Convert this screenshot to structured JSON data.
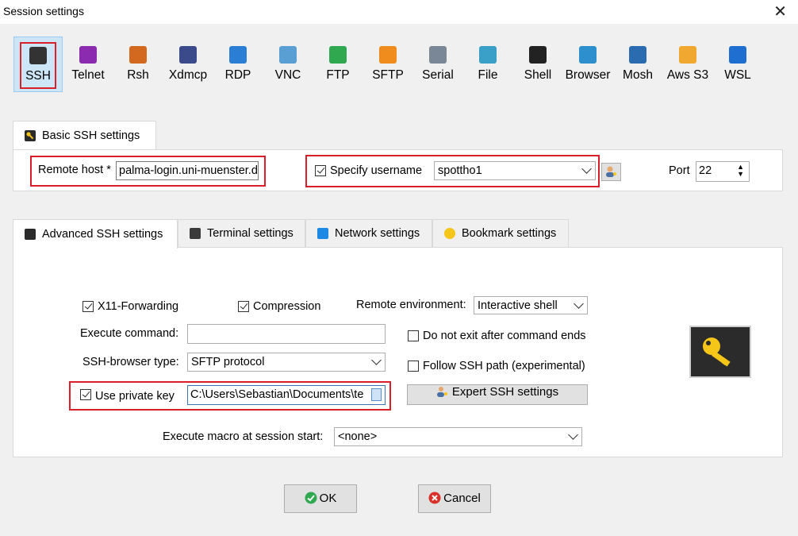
{
  "window": {
    "title": "Session settings",
    "close_glyph": "✕"
  },
  "protocols": [
    {
      "label": "SSH",
      "icon": "ssh-key-icon",
      "color": "#333333",
      "selected": true
    },
    {
      "label": "Telnet",
      "icon": "telnet-icon",
      "color": "#8a2bb0"
    },
    {
      "label": "Rsh",
      "icon": "rsh-icon",
      "color": "#d2691e"
    },
    {
      "label": "Xdmcp",
      "icon": "xdmcp-icon",
      "color": "#3b4a8a"
    },
    {
      "label": "RDP",
      "icon": "rdp-icon",
      "color": "#2a7fd4"
    },
    {
      "label": "VNC",
      "icon": "vnc-icon",
      "color": "#5a9fd4"
    },
    {
      "label": "FTP",
      "icon": "ftp-globe-icon",
      "color": "#2fa84f"
    },
    {
      "label": "SFTP",
      "icon": "sftp-globe-icon",
      "color": "#f08c1e"
    },
    {
      "label": "Serial",
      "icon": "serial-plug-icon",
      "color": "#7a8796"
    },
    {
      "label": "File",
      "icon": "file-monitor-icon",
      "color": "#3aa0c8"
    },
    {
      "label": "Shell",
      "icon": "shell-terminal-icon",
      "color": "#222222"
    },
    {
      "label": "Browser",
      "icon": "browser-globe-icon",
      "color": "#2e8fcf"
    },
    {
      "label": "Mosh",
      "icon": "mosh-antenna-icon",
      "color": "#2b6cb0"
    },
    {
      "label": "Aws S3",
      "icon": "aws-s3-icon",
      "color": "#f0a830"
    },
    {
      "label": "WSL",
      "icon": "wsl-windows-icon",
      "color": "#1e6fd0"
    }
  ],
  "basic": {
    "tab_label": "Basic SSH settings",
    "remote_host_label": "Remote host *",
    "remote_host_value": "palma-login.uni-muenster.d",
    "specify_username_label": "Specify username",
    "specify_username_checked": true,
    "username_value": "spottho1",
    "port_label": "Port",
    "port_value": "22"
  },
  "advanced_tabs": [
    {
      "label": "Advanced SSH settings",
      "active": true
    },
    {
      "label": "Terminal settings"
    },
    {
      "label": "Network settings"
    },
    {
      "label": "Bookmark settings"
    }
  ],
  "advanced": {
    "x11_label": "X11-Forwarding",
    "x11_checked": true,
    "compression_label": "Compression",
    "compression_checked": true,
    "remote_env_label": "Remote environment:",
    "remote_env_value": "Interactive shell",
    "execute_command_label": "Execute command:",
    "execute_command_value": "",
    "no_exit_label": "Do not exit after command ends",
    "no_exit_checked": false,
    "browser_type_label": "SSH-browser type:",
    "browser_type_value": "SFTP protocol",
    "follow_path_label": "Follow SSH path (experimental)",
    "follow_path_checked": false,
    "private_key_label": "Use private key",
    "private_key_checked": true,
    "private_key_value": "C:\\Users\\Sebastian\\Documents\\te",
    "expert_button_label": "Expert SSH settings",
    "macro_label": "Execute macro at session start:",
    "macro_value": "<none>"
  },
  "buttons": {
    "ok_label": "OK",
    "cancel_label": "Cancel"
  }
}
